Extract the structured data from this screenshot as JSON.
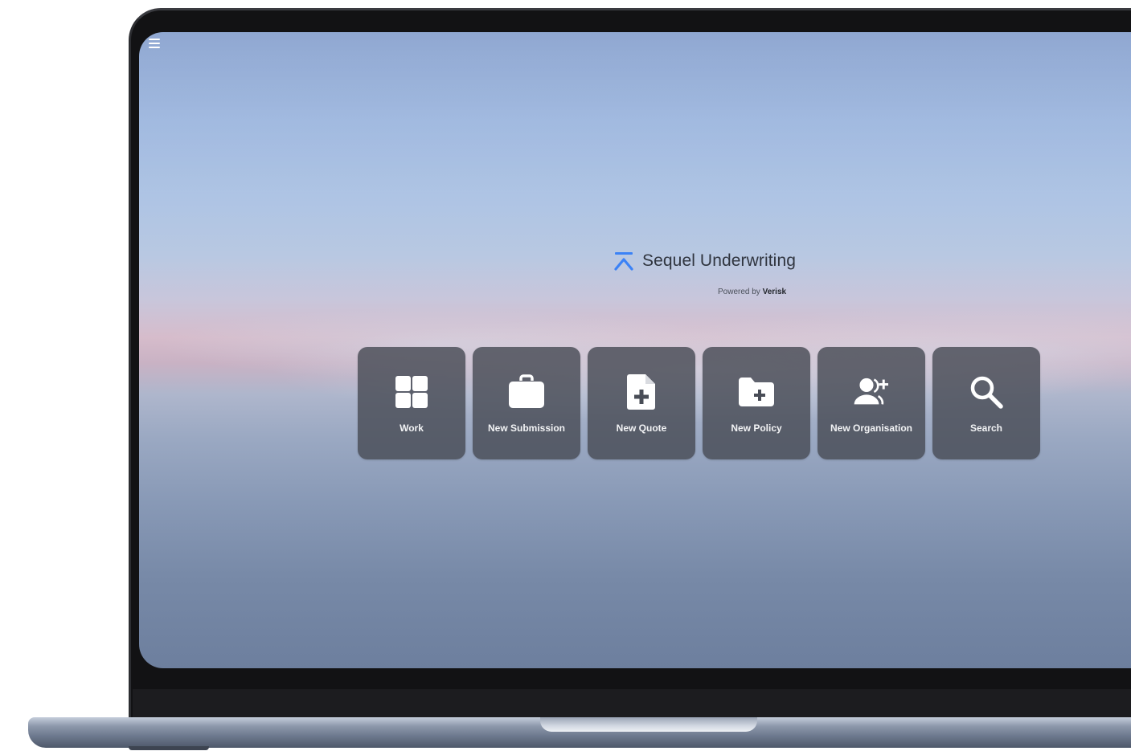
{
  "app": {
    "title": "Sequel Underwriting",
    "powered_prefix": "Powered by",
    "powered_brand": "Verisk"
  },
  "menu": {
    "icon": "hamburger-menu-icon"
  },
  "tiles": [
    {
      "label": "Work",
      "icon": "grid-icon"
    },
    {
      "label": "New Submission",
      "icon": "briefcase-icon"
    },
    {
      "label": "New Quote",
      "icon": "document-plus-icon"
    },
    {
      "label": "New Policy",
      "icon": "folder-plus-icon"
    },
    {
      "label": "New Organisation",
      "icon": "user-plus-icon"
    },
    {
      "label": "Search",
      "icon": "search-icon"
    }
  ],
  "colors": {
    "brand_accent": "#3b82f6",
    "tile_background": "#484c56",
    "tile_text": "#f2f3f5"
  }
}
